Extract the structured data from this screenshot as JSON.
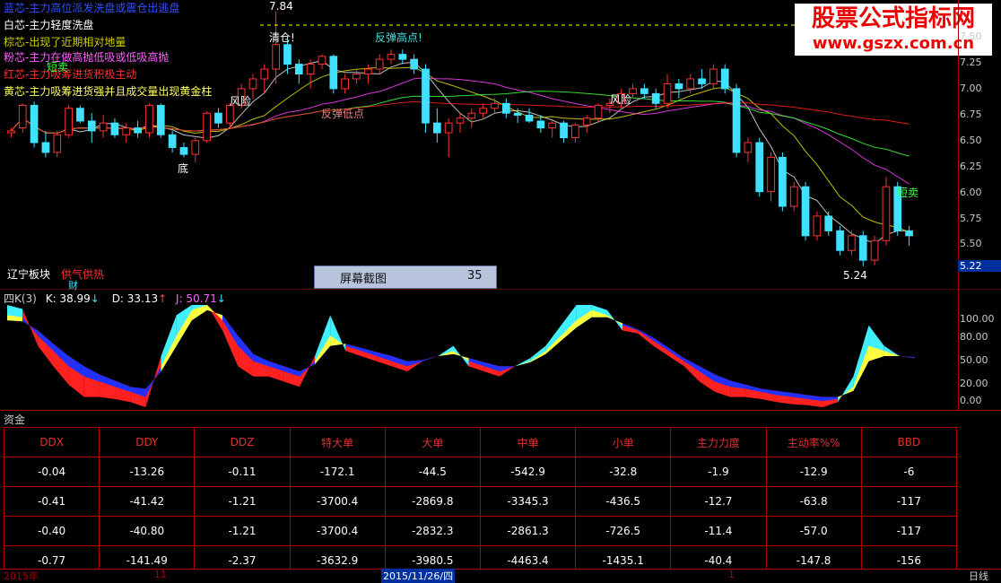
{
  "legend": [
    {
      "text": "蓝芯-主力高位派发洗盘或震仓出逃盘",
      "color": "#3050ff"
    },
    {
      "text": "白芯-主力轻度洗盘",
      "color": "#ffffff"
    },
    {
      "text": "棕芯-出现了近期相对地量",
      "color": "#d0d000"
    },
    {
      "text": "粉芯-主力在做高抛低吸或低吸高抛",
      "color": "#ff60ff"
    },
    {
      "text": "红芯-主力吸筹进货积极主动",
      "color": "#ff3030"
    },
    {
      "text": "黄芯-主力吸筹进货强并且成交量出现黄金柱",
      "color": "#ffff60"
    }
  ],
  "annotations": {
    "high_price": "7.84",
    "low_price": "5.24",
    "clear": "清仓!",
    "rebound_high": "反弹高点!",
    "short_sell_1": "短卖",
    "short_sell_2": "短卖",
    "risk_1": "风险",
    "risk_2": "风险",
    "rebound_low": "反弹低点",
    "bottom": "底",
    "sector": "辽宁板块",
    "hot": "供气供热",
    "finance": "财"
  },
  "price_ticks": [
    "7.50",
    "7.25",
    "7.00",
    "6.75",
    "6.50",
    "6.25",
    "6.00",
    "5.75",
    "5.50"
  ],
  "current_price": "5.22",
  "kdj": {
    "title": "四K(3)",
    "k_label": "K: 38.99",
    "d_label": "D: 33.13",
    "j_label": "J: 50.71",
    "ticks": [
      "100.00",
      "80.00",
      "50.00",
      "20.00",
      "0.00"
    ]
  },
  "screenshot_box": {
    "label": "屏幕截图",
    "count": "35"
  },
  "watermark": {
    "title": "股票公式指标网",
    "url": "www.gszx.com.cn"
  },
  "fund": {
    "title": "资金",
    "headers": [
      "DDX",
      "DDY",
      "DDZ",
      "特大单",
      "大单",
      "中单",
      "小单",
      "主力力度",
      "主动率%%",
      "BBD"
    ],
    "rows": [
      [
        "-0.04",
        "-13.26",
        "-0.11",
        "-172.1",
        "-44.5",
        "-542.9",
        "-32.8",
        "-1.9",
        "-12.9",
        "-6"
      ],
      [
        "-0.41",
        "-41.42",
        "-1.21",
        "-3700.4",
        "-2869.8",
        "-3345.3",
        "-436.5",
        "-12.7",
        "-63.8",
        "-117"
      ],
      [
        "-0.40",
        "-40.80",
        "-1.21",
        "-3700.4",
        "-2832.3",
        "-2861.3",
        "-726.5",
        "-11.4",
        "-57.0",
        "-117"
      ],
      [
        "-0.77",
        "-141.49",
        "-2.37",
        "-3632.9",
        "-3980.5",
        "-4463.4",
        "-1435.1",
        "-40.4",
        "-147.8",
        "-156"
      ]
    ]
  },
  "bottom_bar": {
    "year": "2015年",
    "month": "11",
    "date": "2015/11/26/四",
    "day": "1",
    "period": "日线"
  },
  "chart_data": {
    "type": "candlestick",
    "y_range": [
      5.2,
      7.84
    ],
    "candles": [
      [
        6.6,
        6.65,
        6.55,
        6.62
      ],
      [
        6.65,
        6.9,
        6.6,
        6.88
      ],
      [
        6.88,
        6.92,
        6.45,
        6.5
      ],
      [
        6.5,
        6.62,
        6.35,
        6.4
      ],
      [
        6.4,
        6.62,
        6.35,
        6.58
      ],
      [
        6.58,
        6.88,
        6.55,
        6.85
      ],
      [
        6.85,
        6.88,
        6.7,
        6.72
      ],
      [
        6.72,
        6.8,
        6.5,
        6.62
      ],
      [
        6.62,
        6.78,
        6.55,
        6.7
      ],
      [
        6.7,
        6.75,
        6.55,
        6.58
      ],
      [
        6.58,
        6.7,
        6.5,
        6.65
      ],
      [
        6.65,
        6.72,
        6.55,
        6.6
      ],
      [
        6.6,
        6.9,
        6.55,
        6.88
      ],
      [
        6.88,
        6.9,
        6.55,
        6.58
      ],
      [
        6.58,
        6.62,
        6.4,
        6.45
      ],
      [
        6.45,
        6.5,
        6.35,
        6.38
      ],
      [
        6.38,
        6.55,
        6.3,
        6.52
      ],
      [
        6.52,
        6.82,
        6.5,
        6.8
      ],
      [
        6.8,
        6.85,
        6.65,
        6.7
      ],
      [
        6.7,
        6.9,
        6.65,
        6.88
      ],
      [
        6.88,
        7.1,
        6.85,
        7.05
      ],
      [
        7.05,
        7.2,
        6.95,
        7.15
      ],
      [
        7.15,
        7.3,
        7.0,
        7.25
      ],
      [
        7.25,
        7.84,
        7.1,
        7.5
      ],
      [
        7.5,
        7.55,
        7.2,
        7.3
      ],
      [
        7.3,
        7.35,
        7.1,
        7.2
      ],
      [
        7.2,
        7.35,
        7.05,
        7.3
      ],
      [
        7.3,
        7.4,
        7.25,
        7.38
      ],
      [
        7.38,
        7.4,
        7.0,
        7.05
      ],
      [
        7.05,
        7.2,
        7.0,
        7.15
      ],
      [
        7.15,
        7.25,
        7.1,
        7.2
      ],
      [
        7.2,
        7.3,
        7.1,
        7.25
      ],
      [
        7.25,
        7.4,
        7.2,
        7.35
      ],
      [
        7.35,
        7.45,
        7.3,
        7.4
      ],
      [
        7.4,
        7.45,
        7.3,
        7.35
      ],
      [
        7.35,
        7.4,
        7.2,
        7.25
      ],
      [
        7.25,
        7.3,
        6.6,
        6.7
      ],
      [
        6.7,
        6.85,
        6.5,
        6.6
      ],
      [
        6.6,
        6.75,
        6.35,
        6.7
      ],
      [
        6.7,
        6.8,
        6.6,
        6.75
      ],
      [
        6.75,
        6.85,
        6.65,
        6.8
      ],
      [
        6.8,
        6.9,
        6.75,
        6.85
      ],
      [
        6.85,
        6.95,
        6.8,
        6.9
      ],
      [
        6.9,
        6.95,
        6.75,
        6.8
      ],
      [
        6.8,
        6.85,
        6.7,
        6.78
      ],
      [
        6.78,
        6.85,
        6.7,
        6.72
      ],
      [
        6.72,
        6.78,
        6.6,
        6.65
      ],
      [
        6.65,
        6.72,
        6.55,
        6.7
      ],
      [
        6.7,
        6.72,
        6.5,
        6.55
      ],
      [
        6.55,
        6.7,
        6.5,
        6.68
      ],
      [
        6.68,
        6.78,
        6.6,
        6.75
      ],
      [
        6.75,
        6.9,
        6.7,
        6.88
      ],
      [
        6.88,
        6.95,
        6.8,
        6.9
      ],
      [
        6.9,
        7.05,
        6.85,
        7.0
      ],
      [
        7.0,
        7.1,
        6.95,
        7.05
      ],
      [
        7.05,
        7.1,
        6.95,
        7.0
      ],
      [
        7.0,
        7.05,
        6.85,
        6.9
      ],
      [
        6.9,
        7.2,
        6.85,
        7.1
      ],
      [
        7.1,
        7.15,
        6.95,
        7.05
      ],
      [
        7.05,
        7.2,
        7.0,
        7.15
      ],
      [
        7.15,
        7.25,
        7.05,
        7.1
      ],
      [
        7.1,
        7.3,
        7.05,
        7.25
      ],
      [
        7.25,
        7.3,
        7.0,
        7.05
      ],
      [
        7.05,
        7.1,
        6.35,
        6.4
      ],
      [
        6.4,
        6.55,
        6.3,
        6.5
      ],
      [
        6.5,
        6.55,
        5.95,
        6.0
      ],
      [
        6.0,
        6.4,
        5.9,
        6.35
      ],
      [
        6.35,
        6.4,
        5.8,
        5.85
      ],
      [
        5.85,
        6.1,
        5.8,
        6.05
      ],
      [
        6.05,
        6.1,
        5.5,
        5.55
      ],
      [
        5.55,
        5.8,
        5.5,
        5.75
      ],
      [
        5.75,
        5.8,
        5.55,
        5.6
      ],
      [
        5.6,
        5.65,
        5.35,
        5.4
      ],
      [
        5.4,
        5.6,
        5.35,
        5.55
      ],
      [
        5.55,
        5.6,
        5.24,
        5.3
      ],
      [
        5.3,
        5.55,
        5.25,
        5.5
      ],
      [
        5.5,
        6.15,
        5.45,
        6.05
      ],
      [
        6.05,
        6.1,
        5.55,
        5.6
      ],
      [
        5.6,
        5.65,
        5.45,
        5.55
      ]
    ],
    "kdj_k": [
      90,
      88,
      70,
      55,
      40,
      30,
      25,
      20,
      15,
      10,
      40,
      70,
      95,
      100,
      85,
      60,
      45,
      40,
      35,
      30,
      45,
      70,
      60,
      55,
      50,
      45,
      40,
      45,
      50,
      55,
      45,
      40,
      35,
      40,
      45,
      55,
      70,
      85,
      95,
      90,
      80,
      75,
      65,
      55,
      45,
      35,
      25,
      20,
      18,
      15,
      12,
      10,
      8,
      6,
      8,
      20,
      60,
      55,
      50,
      48
    ],
    "kdj_d": [
      85,
      84,
      75,
      62,
      50,
      40,
      32,
      26,
      20,
      18,
      35,
      60,
      85,
      95,
      90,
      70,
      52,
      45,
      40,
      35,
      42,
      60,
      62,
      58,
      54,
      50,
      45,
      46,
      50,
      52,
      48,
      44,
      40,
      40,
      44,
      52,
      65,
      78,
      88,
      88,
      82,
      76,
      68,
      58,
      48,
      40,
      32,
      26,
      22,
      18,
      16,
      14,
      12,
      10,
      10,
      16,
      45,
      50,
      50,
      49
    ],
    "kdj_j": [
      100,
      96,
      60,
      40,
      22,
      10,
      10,
      8,
      5,
      0,
      50,
      90,
      100,
      100,
      75,
      40,
      30,
      30,
      25,
      20,
      50,
      90,
      55,
      50,
      45,
      40,
      35,
      45,
      50,
      60,
      40,
      35,
      30,
      40,
      48,
      60,
      80,
      100,
      100,
      95,
      75,
      72,
      60,
      50,
      40,
      25,
      15,
      10,
      10,
      8,
      5,
      3,
      2,
      0,
      5,
      30,
      80,
      60,
      50,
      48
    ]
  }
}
